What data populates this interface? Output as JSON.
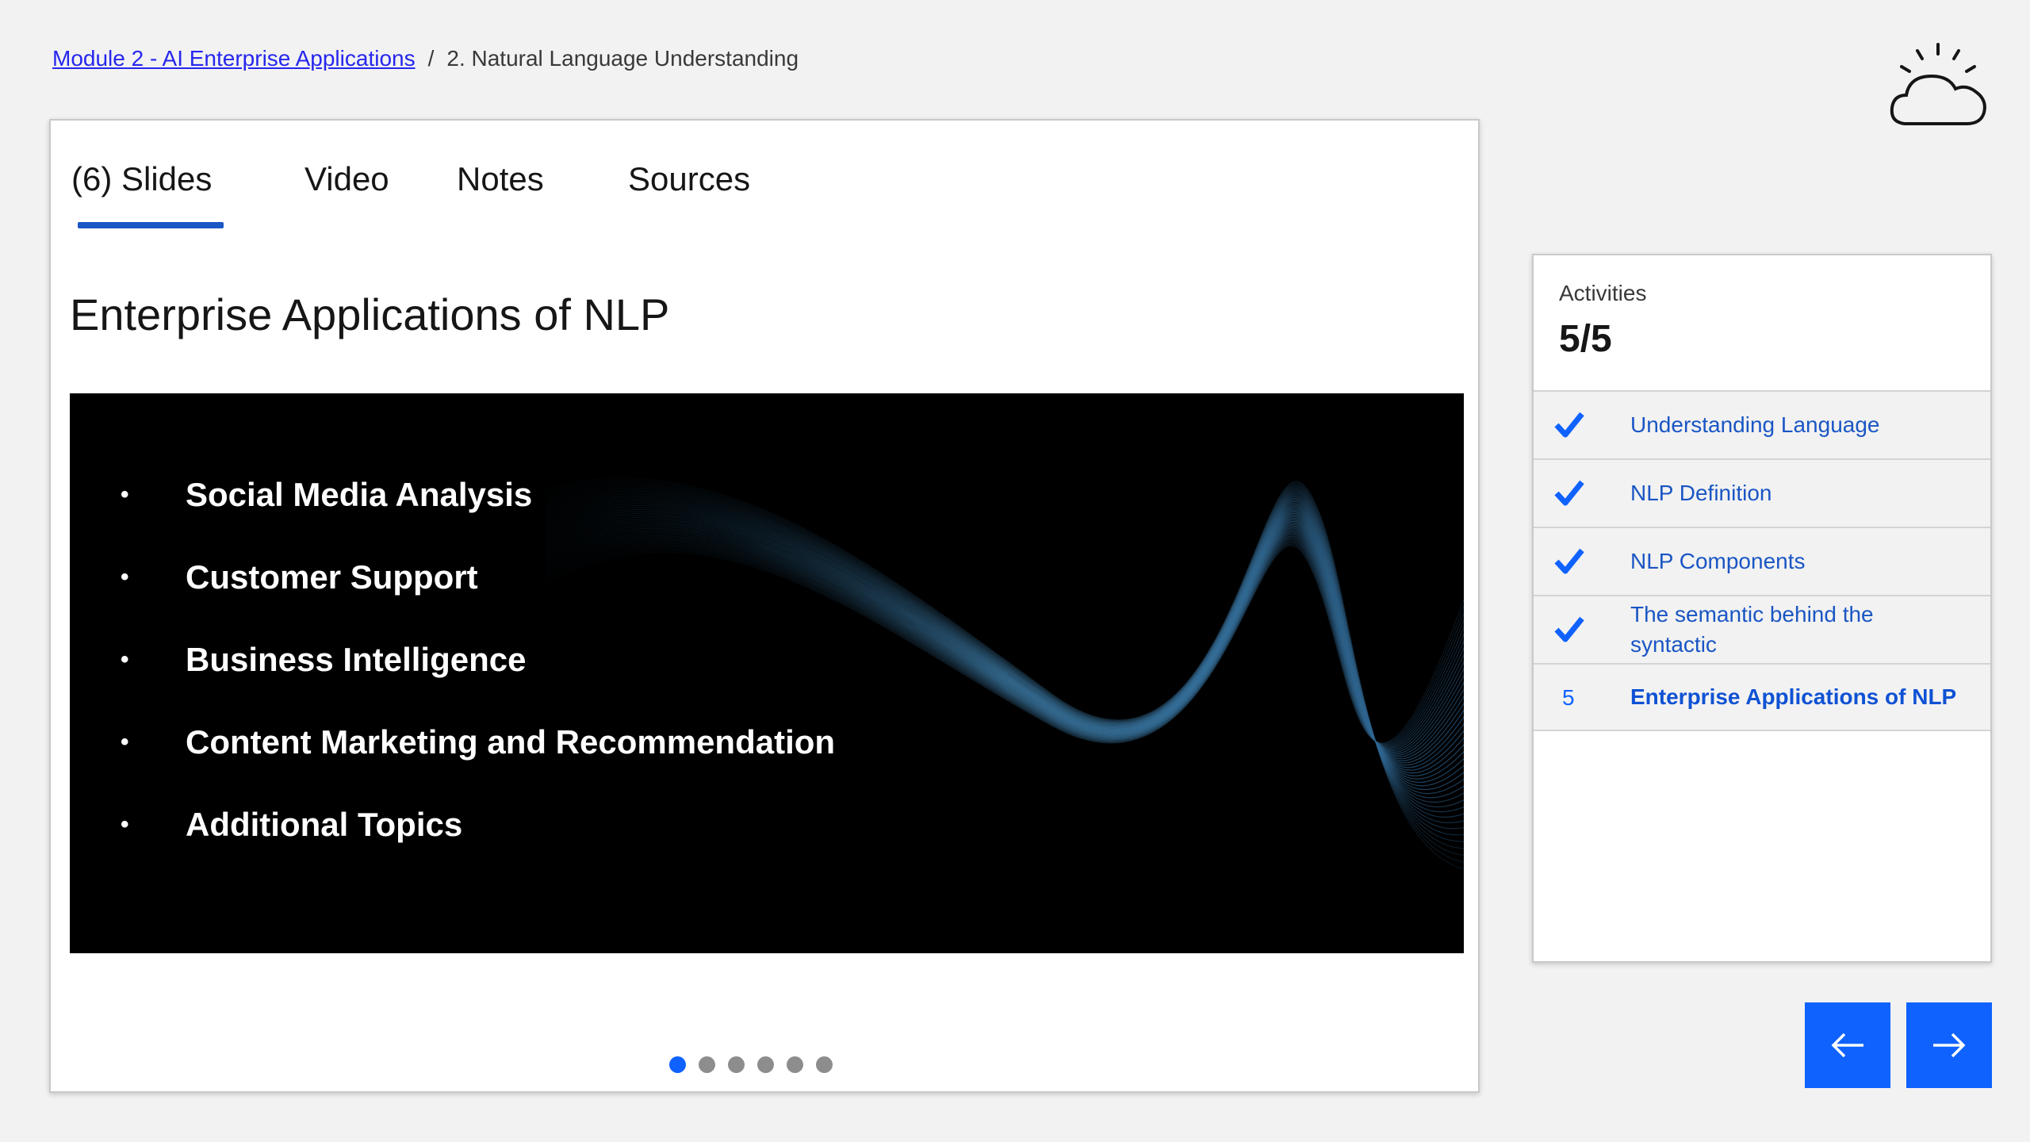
{
  "breadcrumb": {
    "module_link": "Module 2 - AI Enterprise Applications",
    "separator": "/",
    "current": "2. Natural Language Understanding"
  },
  "logo": {
    "icon": "cloud-sun-icon"
  },
  "tabs": [
    {
      "label": "(6) Slides",
      "active": true
    },
    {
      "label": "Video",
      "active": false
    },
    {
      "label": "Notes",
      "active": false
    },
    {
      "label": "Sources",
      "active": false
    }
  ],
  "slide": {
    "title": "Enterprise Applications of NLP",
    "bullet_symbol": "•",
    "items": [
      "Social Media Analysis",
      "Customer Support",
      "Business Intelligence",
      "Content Marketing and Recommendation",
      "Additional Topics"
    ]
  },
  "pagination": {
    "total": 6,
    "current": 1
  },
  "activities": {
    "label": "Activities",
    "count": "5/5",
    "items": [
      {
        "label": "Understanding Language",
        "status": "done"
      },
      {
        "label": "NLP Definition",
        "status": "done"
      },
      {
        "label": "NLP Components",
        "status": "done"
      },
      {
        "label": "The semantic behind the syntactic",
        "status": "done"
      },
      {
        "label": "Enterprise Applications of NLP",
        "status": "current",
        "number": "5"
      }
    ]
  },
  "nav": {
    "prev_icon": "arrow-left-icon",
    "next_icon": "arrow-right-icon"
  },
  "colors": {
    "accent": "#0f62fe",
    "link": "#2626ee",
    "background": "#f2f2f2"
  }
}
